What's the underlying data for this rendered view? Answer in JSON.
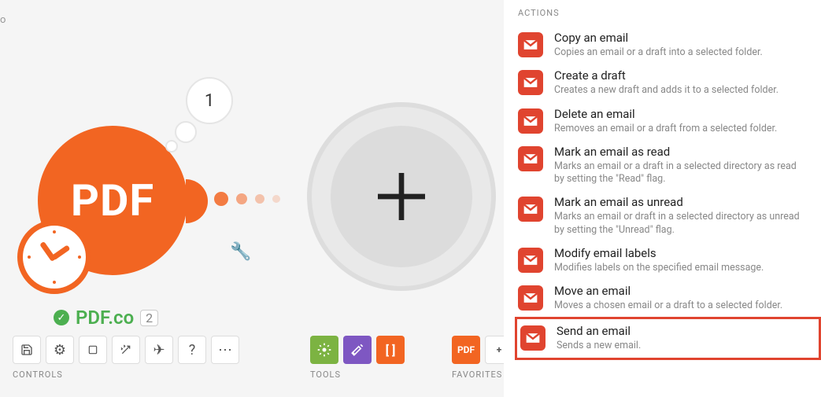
{
  "canvas": {
    "node_label": "PDF",
    "badge_number": "1",
    "app_name": "PDF.co",
    "instance_count": "2",
    "stray_char": "o"
  },
  "sections": {
    "controls": "CONTROLS",
    "tools": "TOOLS",
    "favorites": "FAVORITES",
    "actions_header": "ACTIONS",
    "fav_pdf": "PDF"
  },
  "actions": [
    {
      "title": "Copy an email",
      "desc": "Copies an email or a draft into a selected folder."
    },
    {
      "title": "Create a draft",
      "desc": "Creates a new draft and adds it to a selected folder."
    },
    {
      "title": "Delete an email",
      "desc": "Removes an email or a draft from a selected folder."
    },
    {
      "title": "Mark an email as read",
      "desc": "Marks an email or a draft in a selected directory as read by setting the \"Read\" flag."
    },
    {
      "title": "Mark an email as unread",
      "desc": "Marks an email or draft in a selected directory as unread by setting the \"Unread\" flag."
    },
    {
      "title": "Modify email labels",
      "desc": "Modifies labels on the specified email message."
    },
    {
      "title": "Move an email",
      "desc": "Moves a chosen email or a draft to a selected folder."
    },
    {
      "title": "Send an email",
      "desc": "Sends a new email."
    }
  ],
  "colors": {
    "accent": "#f26522",
    "gmail": "#e0442f",
    "ok": "#4caf50"
  }
}
